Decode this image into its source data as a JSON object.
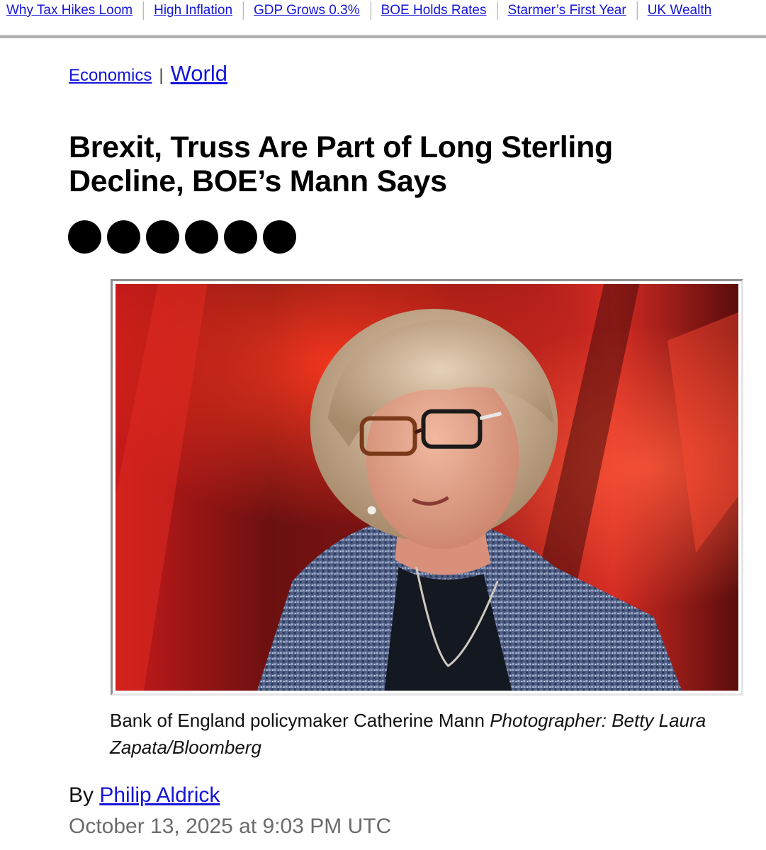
{
  "topnav": {
    "links": [
      "Why Tax Hikes Loom",
      "High Inflation",
      "GDP Grows 0.3%",
      "BOE Holds Rates",
      "Starmer’s First Year",
      "UK Wealth"
    ]
  },
  "breadcrumb": {
    "primary": "Economics",
    "separator": "|",
    "secondary": "World"
  },
  "article": {
    "headline": "Brexit, Truss Are Part of Long Sterling Decline, BOE’s Mann Says",
    "share_icons": [
      "share-icon",
      "share-icon",
      "share-icon",
      "share-icon",
      "share-icon",
      "share-icon"
    ],
    "caption": "Bank of England policymaker Catherine Mann",
    "credit": "Photographer: Betty Laura Zapata/Bloomberg",
    "byline_prefix": "By",
    "author": "Philip Aldrick",
    "date": "October 13, 2025 at 9:03 PM UTC"
  },
  "colors": {
    "link": "#1515d9",
    "date_text": "#6b6b6b",
    "photo_background": "#b3181c"
  }
}
